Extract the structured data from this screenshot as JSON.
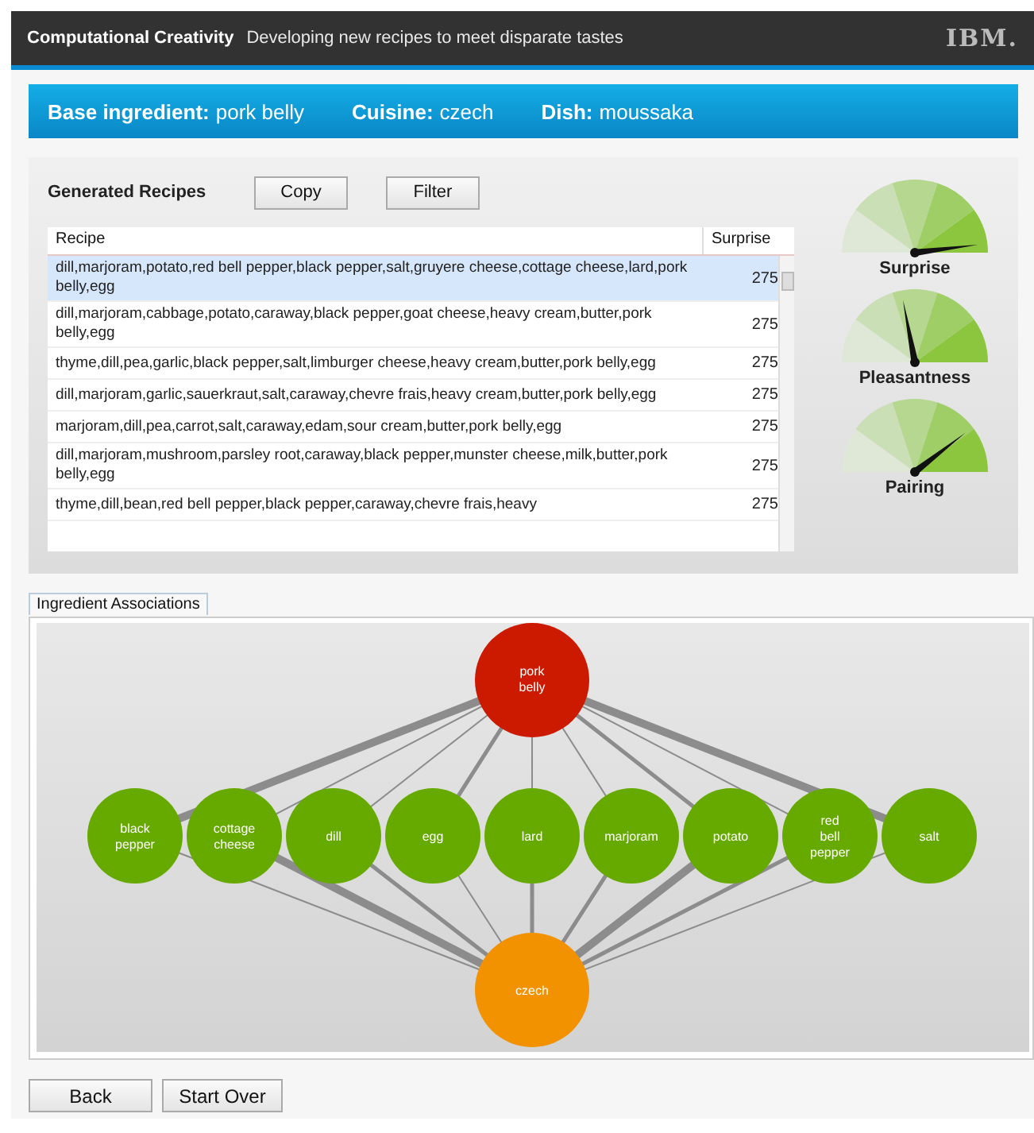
{
  "header": {
    "title": "Computational Creativity",
    "subtitle": "Developing new recipes to meet disparate tastes",
    "logo": "IBM."
  },
  "banner": [
    {
      "label": "Base ingredient:",
      "value": "pork belly"
    },
    {
      "label": "Cuisine:",
      "value": "czech"
    },
    {
      "label": "Dish:",
      "value": "moussaka"
    }
  ],
  "recipes_panel": {
    "title": "Generated Recipes",
    "buttons": [
      "Copy",
      "Filter"
    ],
    "table": {
      "columns": [
        "Recipe",
        "Surprise"
      ],
      "rows": [
        {
          "recipe": "dill,marjoram,potato,red bell pepper,black pepper,salt,gruyere cheese,cottage cheese,lard,pork belly,egg",
          "surprise": "275",
          "selected": true
        },
        {
          "recipe": "dill,marjoram,cabbage,potato,caraway,black pepper,goat cheese,heavy cream,butter,pork belly,egg",
          "surprise": "275",
          "selected": false
        },
        {
          "recipe": "thyme,dill,pea,garlic,black pepper,salt,limburger cheese,heavy cream,butter,pork belly,egg",
          "surprise": "275",
          "selected": false
        },
        {
          "recipe": "dill,marjoram,garlic,sauerkraut,salt,caraway,chevre frais,heavy cream,butter,pork belly,egg",
          "surprise": "275",
          "selected": false
        },
        {
          "recipe": "marjoram,dill,pea,carrot,salt,caraway,edam,sour cream,butter,pork belly,egg",
          "surprise": "275",
          "selected": false
        },
        {
          "recipe": "dill,marjoram,mushroom,parsley root,caraway,black pepper,munster cheese,milk,butter,pork belly,egg",
          "surprise": "275",
          "selected": false
        },
        {
          "recipe": "thyme,dill,bean,red bell pepper,black pepper,caraway,chevre frais,heavy",
          "surprise": "275",
          "selected": false
        }
      ]
    }
  },
  "gauges": [
    {
      "label": "Surprise"
    },
    {
      "label": "Pleasantness"
    },
    {
      "label": "Pairing"
    }
  ],
  "associations": {
    "tab": "Ingredient Associations",
    "base": {
      "label": "pork belly"
    },
    "cuisine": {
      "label": "czech"
    },
    "ingredients": [
      {
        "label": "black pepper"
      },
      {
        "label": "cottage cheese"
      },
      {
        "label": "dill"
      },
      {
        "label": "egg"
      },
      {
        "label": "lard"
      },
      {
        "label": "marjoram"
      },
      {
        "label": "potato"
      },
      {
        "label": "red bell pepper"
      },
      {
        "label": "salt"
      }
    ]
  },
  "footer_buttons": [
    "Back",
    "Start Over"
  ]
}
